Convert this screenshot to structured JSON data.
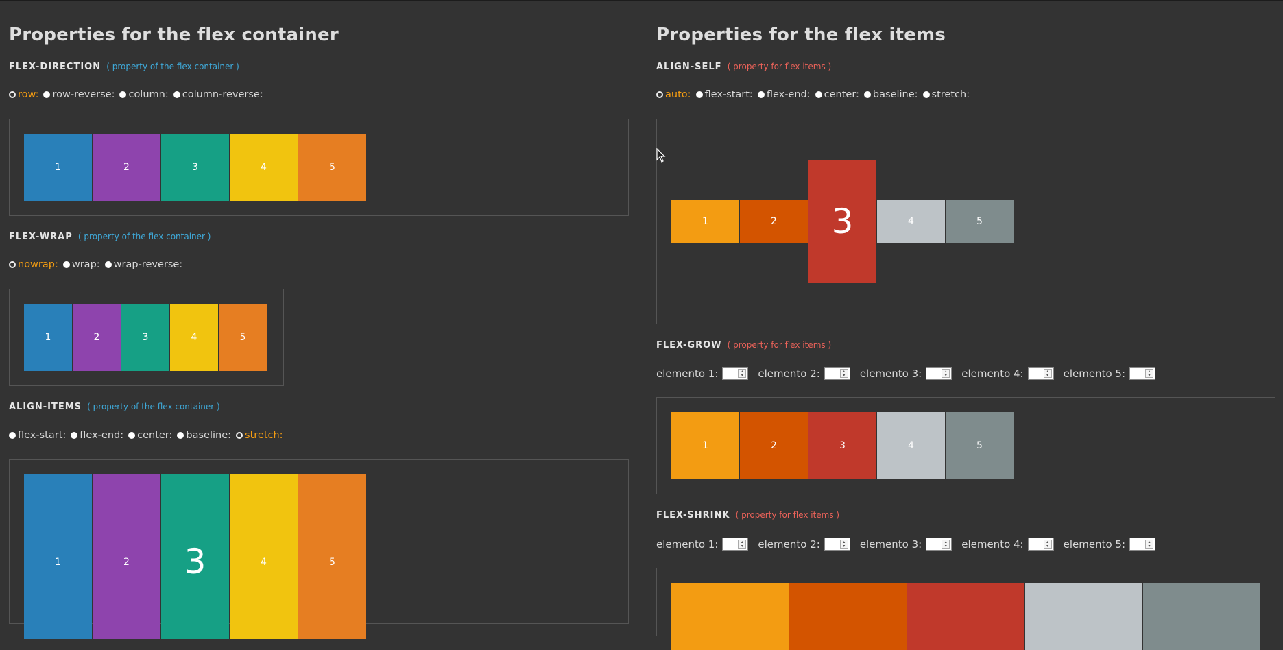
{
  "left": {
    "heading": "Properties for the flex container",
    "sections": [
      {
        "name": "FLEX-DIRECTION",
        "note": "( property of the flex container )",
        "options": [
          "row:",
          "row-reverse:",
          "column:",
          "column-reverse:"
        ],
        "selected": 0,
        "items": [
          "1",
          "2",
          "3",
          "4",
          "5"
        ]
      },
      {
        "name": "FLEX-WRAP",
        "note": "( property of the flex container )",
        "options": [
          "nowrap:",
          "wrap:",
          "wrap-reverse:"
        ],
        "selected": 0,
        "items": [
          "1",
          "2",
          "3",
          "4",
          "5"
        ]
      },
      {
        "name": "ALIGN-ITEMS",
        "note": "( property of the flex container )",
        "options": [
          "flex-start:",
          "flex-end:",
          "center:",
          "baseline:",
          "stretch:"
        ],
        "selected": 4,
        "items": [
          "1",
          "2",
          "3",
          "4",
          "5"
        ]
      }
    ]
  },
  "right": {
    "heading": "Properties for the flex items",
    "sections": [
      {
        "name": "ALIGN-SELF",
        "note": "( property for flex items )",
        "options": [
          "auto:",
          "flex-start:",
          "flex-end:",
          "center:",
          "baseline:",
          "stretch:"
        ],
        "selected": 0,
        "items": [
          "1",
          "2",
          "3",
          "4",
          "5"
        ]
      },
      {
        "name": "FLEX-GROW",
        "note": "( property for flex items )",
        "inputs": [
          "elemento 1:",
          "elemento 2:",
          "elemento 3:",
          "elemento 4:",
          "elemento 5:"
        ],
        "items": [
          "1",
          "2",
          "3",
          "4",
          "5"
        ]
      },
      {
        "name": "FLEX-SHRINK",
        "note": "( property for flex items )",
        "inputs": [
          "elemento 1:",
          "elemento 2:",
          "elemento 3:",
          "elemento 4:",
          "elemento 5:"
        ]
      }
    ]
  },
  "colors": {
    "container_items": [
      "#2980b9",
      "#8e44ad",
      "#16a085",
      "#f1c40f",
      "#e67e22"
    ],
    "flex_items": [
      "#f39c12",
      "#d35400",
      "#c0392b",
      "#bdc3c7",
      "#7f8c8d"
    ],
    "note_container": "#3fa9d8",
    "note_items": "#ea6259",
    "selected_option": "#f39c12",
    "background": "#333333"
  },
  "icons": {
    "cursor": "mouse-pointer-icon"
  }
}
